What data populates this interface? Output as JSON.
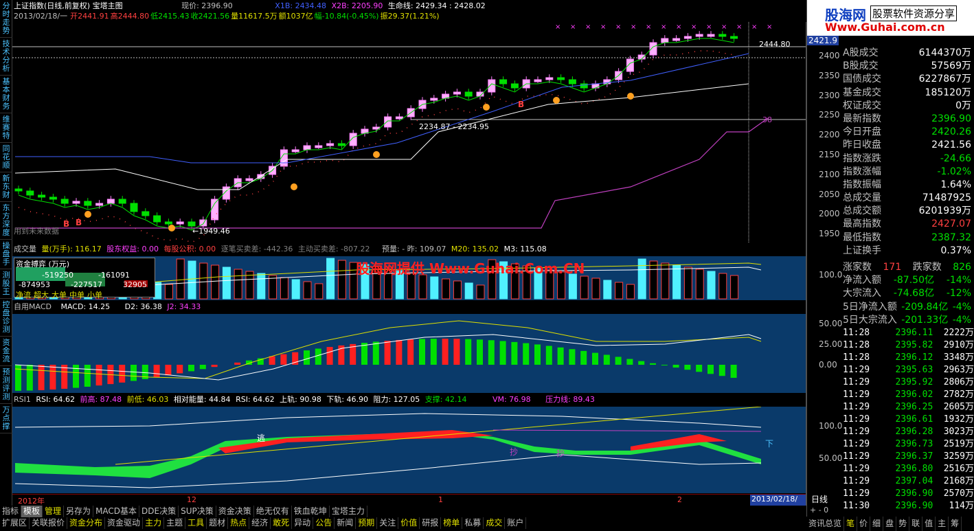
{
  "left_nav": [
    "分时走势",
    "技术分析",
    "基本财务",
    "维赛特",
    "同花顺",
    "新东财",
    "东方深度",
    "操盘手",
    "测股王",
    "控盘诊测",
    "资金流",
    "预测评测",
    "万点撑"
  ],
  "header": {
    "line1": {
      "title": "上证指数(日线,前复权) 宝塔主图",
      "price_label": "现价: 2396.90",
      "x1b": "X1B: 2434.48",
      "x2b": "X2B: 2205.90",
      "life": "生命线: 2429.34 : 2428.02"
    },
    "line2": {
      "date": "2013/02/18/一",
      "open": "开2441.91",
      "high": "高2444.80",
      "low": "低2415.43",
      "close": "收2421.56",
      "vol": "量11617.5万",
      "amt": "额1037亿",
      "chg": "幅-10.84(-0.45%)",
      "amp": "振29.37(1.21%)"
    }
  },
  "main_chart": {
    "yaxis": [
      "2400",
      "2350",
      "2300",
      "2250",
      "2200",
      "2150",
      "2100",
      "2050",
      "2000",
      "1950"
    ],
    "current_tag": "2421.9",
    "top_tag": "2444.80",
    "label_high": "2444.80",
    "label_low": "←1949.46",
    "label_mid": "2234.87 - 2234.95",
    "label_38": "38",
    "watermark_note": "用到未来数据",
    "b_marks": [
      "B",
      "B",
      "B"
    ]
  },
  "brand": {
    "logo": "股海网",
    "slogan": "股票软件资源分享",
    "url": "Www.Guhai.com.cn"
  },
  "volume_panel": {
    "legend": {
      "title": "成交量",
      "l1": "量(万手): 116.17",
      "l2": "股东权益: 0.00",
      "l3": "每股公积: 0.00",
      "l4": "逐笔买卖差: -442.36",
      "l5": "主动买卖差: -807.22",
      "l6": "预量: - 昨: 109.07",
      "l7": "M20: 135.02",
      "l8": "M3: 115.08"
    },
    "yaxis": [
      "100.0"
    ],
    "fund_box": {
      "title": "资金搏弈 (万元)",
      "v1": "-519250",
      "v2": "-161091",
      "v3": "-874953",
      "v4": "-227517",
      "v5": "32905",
      "labels": [
        "净流",
        "超大",
        "大单",
        "中单",
        "小单"
      ]
    },
    "watermark": "股海网提供 Www.Guhai.Com.CN"
  },
  "macd_panel": {
    "legend": {
      "title": "自用MACD",
      "macd": "MACD: 14.25",
      "d2": "D2: 36.38",
      "j2": "J2: 34.33"
    },
    "yaxis": [
      "50.00",
      "25.00",
      "0.00"
    ]
  },
  "rsi_panel": {
    "legend": {
      "title": "RSI1",
      "rsi": "RSI: 64.62",
      "high": "前高: 87.48",
      "low": "前低: 46.03",
      "rel": "相对能量: 44.84",
      "rsi2": "RSI: 64.62",
      "up": "上轨: 90.98",
      "down": "下轨: 46.90",
      "res": "阻力: 127.05",
      "sup": "支撑: 42.14",
      "vm": "VM: 76.98",
      "pres": "压力线: 89.43"
    },
    "yaxis": [
      "100.0",
      "50.00"
    ],
    "marks": {
      "tao": "逃",
      "chao1": "抄",
      "chao2": "抄",
      "xia": "下"
    }
  },
  "xaxis": {
    "labels": [
      "2012年",
      "12",
      "1",
      "2"
    ],
    "cursor_date": "2013/02/18/一",
    "period": "日线",
    "zoom": "+ - 0"
  },
  "stats": [
    {
      "k": "A股成交",
      "v": "6144370万",
      "c": "#ffffff"
    },
    {
      "k": "B股成交",
      "v": "57569万",
      "c": "#ffffff"
    },
    {
      "k": "国债成交",
      "v": "6227867万",
      "c": "#ffffff"
    },
    {
      "k": "基金成交",
      "v": "185120万",
      "c": "#ffffff"
    },
    {
      "k": "权证成交",
      "v": "0万",
      "c": "#ffffff"
    },
    {
      "k": "最新指数",
      "v": "2396.90",
      "c": "#00e000"
    },
    {
      "k": "今日开盘",
      "v": "2420.26",
      "c": "#00e000"
    },
    {
      "k": "昨日收盘",
      "v": "2421.56",
      "c": "#ffffff"
    },
    {
      "k": "指数涨跌",
      "v": "-24.66",
      "c": "#00e000"
    },
    {
      "k": "指数涨幅",
      "v": "-1.02%",
      "c": "#00e000"
    },
    {
      "k": "指数振幅",
      "v": "1.64%",
      "c": "#ffffff"
    },
    {
      "k": "总成交量",
      "v": "71487925",
      "c": "#ffffff"
    },
    {
      "k": "总成交额",
      "v": "6201939万",
      "c": "#ffffff"
    },
    {
      "k": "最高指数",
      "v": "2427.07",
      "c": "#ff4040"
    },
    {
      "k": "最低指数",
      "v": "2387.32",
      "c": "#00e000"
    },
    {
      "k": "上证换手",
      "v": "0.37%",
      "c": "#ffffff"
    }
  ],
  "flows": {
    "up_label": "涨家数",
    "up": "171",
    "down_label": "跌家数",
    "down": "826",
    "rows": [
      {
        "k": "净流入额",
        "v": "-87.50亿",
        "p": "-14%"
      },
      {
        "k": "大宗流入",
        "v": "-74.68亿",
        "p": "-12%"
      },
      {
        "k": "5日净流入额",
        "v": "-209.84亿",
        "p": "-4%"
      },
      {
        "k": "5日大宗流入",
        "v": "-201.33亿",
        "p": "-4%"
      }
    ]
  },
  "ticks": [
    {
      "t": "11:28",
      "p": "2396.11",
      "v": "2222万"
    },
    {
      "t": "11:28",
      "p": "2395.82",
      "v": "2910万"
    },
    {
      "t": "11:28",
      "p": "2396.12",
      "v": "3348万"
    },
    {
      "t": "11:29",
      "p": "2395.63",
      "v": "2963万"
    },
    {
      "t": "11:29",
      "p": "2395.92",
      "v": "2806万"
    },
    {
      "t": "11:29",
      "p": "2396.02",
      "v": "2782万"
    },
    {
      "t": "11:29",
      "p": "2396.25",
      "v": "2605万"
    },
    {
      "t": "11:29",
      "p": "2396.61",
      "v": "1932万"
    },
    {
      "t": "11:29",
      "p": "2396.28",
      "v": "3023万"
    },
    {
      "t": "11:29",
      "p": "2396.73",
      "v": "2519万"
    },
    {
      "t": "11:29",
      "p": "2396.37",
      "v": "3259万"
    },
    {
      "t": "11:29",
      "p": "2396.80",
      "v": "2516万"
    },
    {
      "t": "11:29",
      "p": "2397.04",
      "v": "2168万"
    },
    {
      "t": "11:29",
      "p": "2396.90",
      "v": "2570万"
    },
    {
      "t": "11:30",
      "p": "2396.90",
      "v": "114万"
    }
  ],
  "bottom_tabs_1": [
    "指标",
    "模板",
    "管理",
    "另存为",
    "MACD基本",
    "DDE决策",
    "SUP决策",
    "资金决策",
    "绝无仅有",
    "铁血乾坤",
    "宝塔主力"
  ],
  "bottom_tabs_2": [
    "扩展区",
    "关联报价",
    "资金分布",
    "资金驱动",
    "主力",
    "主题",
    "工具",
    "题材",
    "热点",
    "经济",
    "敢死",
    "异动",
    "公告",
    "新闻",
    "预期",
    "关注",
    "价值",
    "研报",
    "榜单",
    "私募",
    "成交",
    "账户"
  ],
  "right_bottom_tabs": [
    "资讯总览",
    "笔",
    "价",
    "细",
    "盘",
    "势",
    "联",
    "值",
    "主",
    "筹"
  ],
  "colors": {
    "up": "#ff40ff",
    "down": "#00e000",
    "bg_panel": "#0a3a6a",
    "accent": "#4cc3ff"
  }
}
